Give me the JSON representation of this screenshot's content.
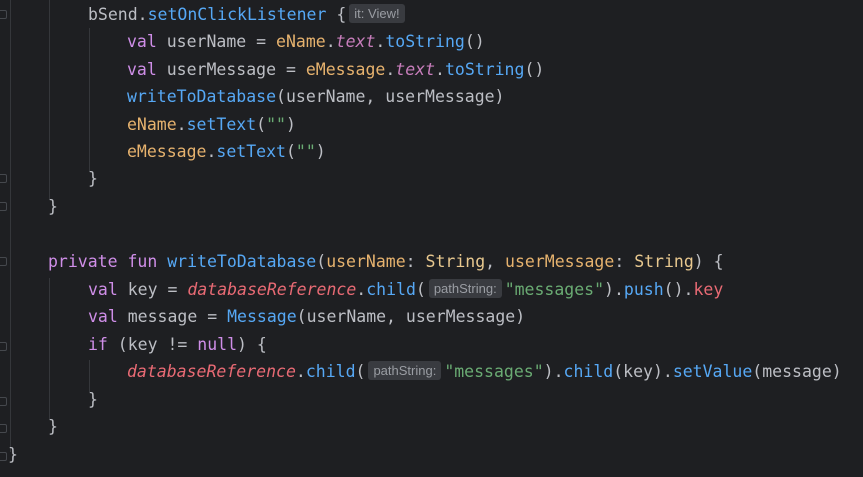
{
  "editor": {
    "hints": {
      "it": "it: View!",
      "path1": "pathString:",
      "path2": "pathString:"
    },
    "tokens": {
      "bSend": "bSend",
      "setOnClickListener": "setOnClickListener",
      "brace_open": " {",
      "val": "val",
      "userName": "userName",
      "eq": " = ",
      "eName": "eName",
      "dot": ".",
      "text": "text",
      "toString": "toString",
      "parens": "()",
      "userMessage": "userMessage",
      "eMessage": "eMessage",
      "writeToDatabase": "writeToDatabase",
      "args_write": "(userName, userMessage)",
      "setText": "setText",
      "empty_str_args_open": "(",
      "empty_str": "\"\"",
      "close_paren": ")",
      "close_brace": "}",
      "private": "private",
      "fun": "fun",
      "open_paren": "(",
      "colon_sp": ": ",
      "String": "String",
      "comma_sp": ", ",
      "sig_close": ") {",
      "key": "key",
      "databaseReference": "databaseReference",
      "child": "child",
      "messages_str": "\"messages\"",
      "push": "push",
      "message": "message",
      "Message": "Message",
      "args_message": "(userName, userMessage)",
      "if": "if",
      "if_cond_open": " (key != ",
      "null": "null",
      "if_cond_close": ") {",
      "child_key_args": "(key).",
      "setValue": "setValue",
      "setValue_args": "(message)"
    }
  }
}
